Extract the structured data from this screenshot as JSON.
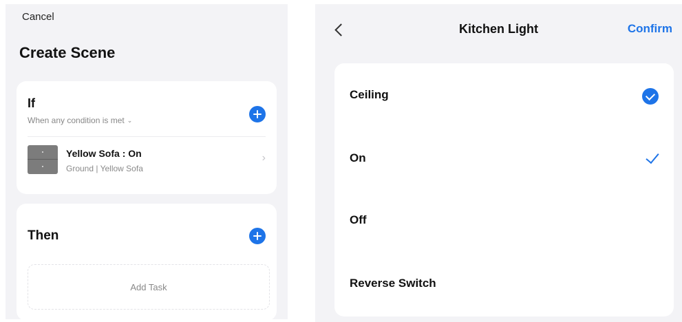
{
  "scene": {
    "cancel_label": "Cancel",
    "title": "Create Scene",
    "if_card": {
      "title": "If",
      "condition_mode": "When any condition is met",
      "condition": {
        "name": "Yellow Sofa : On",
        "location": "Ground  | Yellow Sofa"
      }
    },
    "then_card": {
      "title": "Then",
      "add_task_label": "Add Task"
    },
    "accent_color": "#1e74e8"
  },
  "device_panel": {
    "title": "Kitchen Light",
    "confirm_label": "Confirm",
    "options": [
      {
        "label": "Ceiling",
        "selected": true
      },
      {
        "label": "On",
        "selected": true
      },
      {
        "label": "Off",
        "selected": false
      },
      {
        "label": "Reverse Switch",
        "selected": false
      }
    ]
  },
  "icons": {
    "back": "chevron-left-icon",
    "add": "plus-circle-icon",
    "dropdown": "chevron-down-icon",
    "row_arrow": "chevron-right-icon",
    "selected_circle": "check-circle-icon",
    "selected_mark": "check-icon"
  }
}
